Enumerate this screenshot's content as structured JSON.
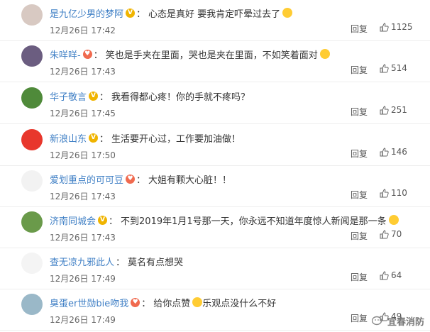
{
  "comments": [
    {
      "user": "是九亿少男的梦阿",
      "badge": "V",
      "text": "心态是真好 要我肯定吓晕过去了",
      "emoji": "grinning-sweat-emoji",
      "time": "12月26日 17:42",
      "reply": "回复",
      "likes": "1125",
      "avatar_color": "#d8c9c2"
    },
    {
      "user": "朱咩咩-",
      "badge": "heart",
      "text": "笑也是手夹在里面，哭也是夹在里面，不如笑着面对",
      "emoji": "tears-of-joy-emoji",
      "time": "12月26日 17:43",
      "reply": "回复",
      "likes": "514",
      "avatar_color": "#6b5d80"
    },
    {
      "user": "华子敬言",
      "badge": "V",
      "text": "我看得都心疼！你的手就不疼吗？",
      "emoji": "",
      "time": "12月26日 17:45",
      "reply": "回复",
      "likes": "251",
      "avatar_color": "#4f8a3a"
    },
    {
      "user": "新浪山东",
      "badge": "V",
      "text": "生活要开心过，工作要加油做！",
      "emoji": "",
      "time": "12月26日 17:50",
      "reply": "回复",
      "likes": "146",
      "avatar_color": "#e8372c"
    },
    {
      "user": "爱划重点的可可豆",
      "badge": "heart",
      "text": "大姐有颗大心脏！！",
      "emoji": "",
      "time": "12月26日 17:43",
      "reply": "回复",
      "likes": "110",
      "avatar_color": "#f2f2f2"
    },
    {
      "user": "济南同城会",
      "badge": "V",
      "text": "不到2019年1月1号那一天，你永远不知道年度惊人新闻是那一条",
      "emoji": "crying-face-emoji",
      "time": "12月26日 17:43",
      "reply": "回复",
      "likes": "70",
      "avatar_color": "#6a9a4a"
    },
    {
      "user": "查无凉九邪此人",
      "badge": "",
      "text": "莫名有点想哭",
      "emoji": "",
      "time": "12月26日 17:49",
      "reply": "回复",
      "likes": "64",
      "avatar_color": "#f4f4f4"
    },
    {
      "user": "臭蛋er世勋bie吻我",
      "badge": "heart",
      "text": "给你点赞",
      "text2": "乐观点没什么不好",
      "emoji": "thumbs-up-emoji",
      "time": "12月26日 17:49",
      "reply": "回复",
      "likes": "49",
      "avatar_color": "#9ab8c8"
    }
  ],
  "watermark": "宜春消防"
}
